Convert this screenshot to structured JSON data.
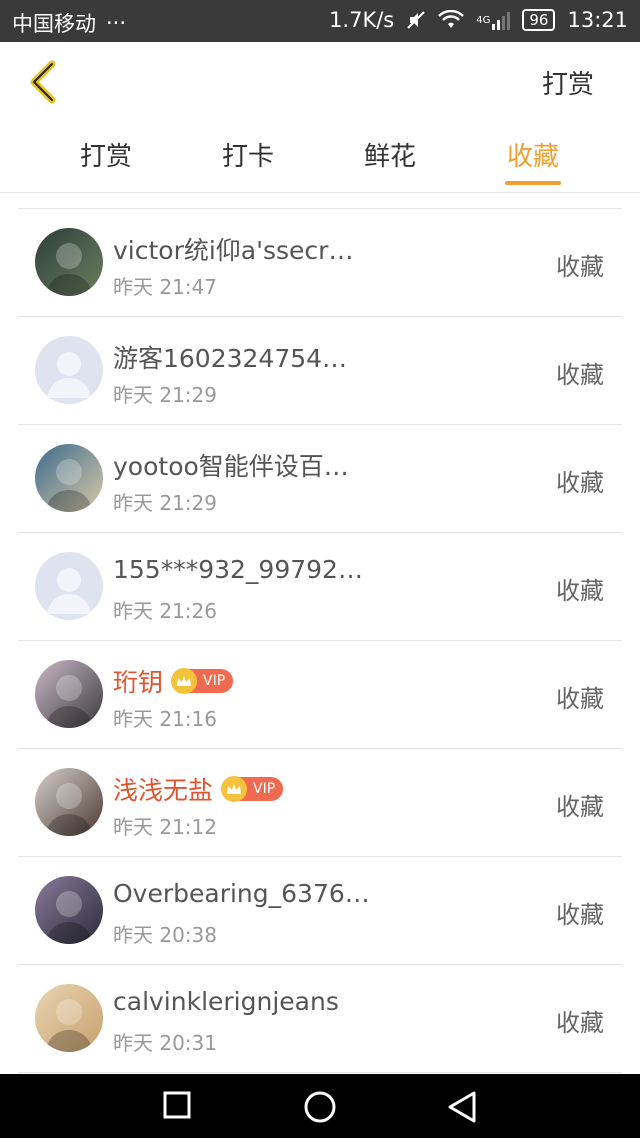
{
  "status_bar": {
    "carrier": "中国移动",
    "dots": "···",
    "speed": "1.7K/s",
    "network": "4G",
    "battery": "96",
    "time": "13:21"
  },
  "header": {
    "action_label": "打赏"
  },
  "tabs": [
    {
      "label": "打赏",
      "active": false
    },
    {
      "label": "打卡",
      "active": false
    },
    {
      "label": "鲜花",
      "active": false
    },
    {
      "label": "收藏",
      "active": true
    }
  ],
  "colors": {
    "accent": "#f0a030",
    "vip_name": "#e0552f"
  },
  "list": [
    {
      "name": "victor统i仰a'ssecr…",
      "time": "昨天 21:47",
      "action": "收藏",
      "vip": false,
      "avatar": "photo-avatar"
    },
    {
      "name": "游客1602324754…",
      "time": "昨天 21:29",
      "action": "收藏",
      "vip": false,
      "avatar": "default-avatar"
    },
    {
      "name": "yootoo智能伴设百…",
      "time": "昨天 21:29",
      "action": "收藏",
      "vip": false,
      "avatar": "photo-avatar"
    },
    {
      "name": "155***932_99792…",
      "time": "昨天 21:26",
      "action": "收藏",
      "vip": false,
      "avatar": "default-avatar"
    },
    {
      "name": "珩钥",
      "time": "昨天 21:16",
      "action": "收藏",
      "vip": true,
      "vip_label": "VIP",
      "avatar": "photo-avatar"
    },
    {
      "name": "浅浅无盐",
      "time": "昨天 21:12",
      "action": "收藏",
      "vip": true,
      "vip_label": "VIP",
      "avatar": "photo-avatar"
    },
    {
      "name": "Overbearing_6376…",
      "time": "昨天 20:38",
      "action": "收藏",
      "vip": false,
      "avatar": "photo-avatar"
    },
    {
      "name": "calvinklerignjeans",
      "time": "昨天 20:31",
      "action": "收藏",
      "vip": false,
      "avatar": "photo-avatar"
    }
  ]
}
